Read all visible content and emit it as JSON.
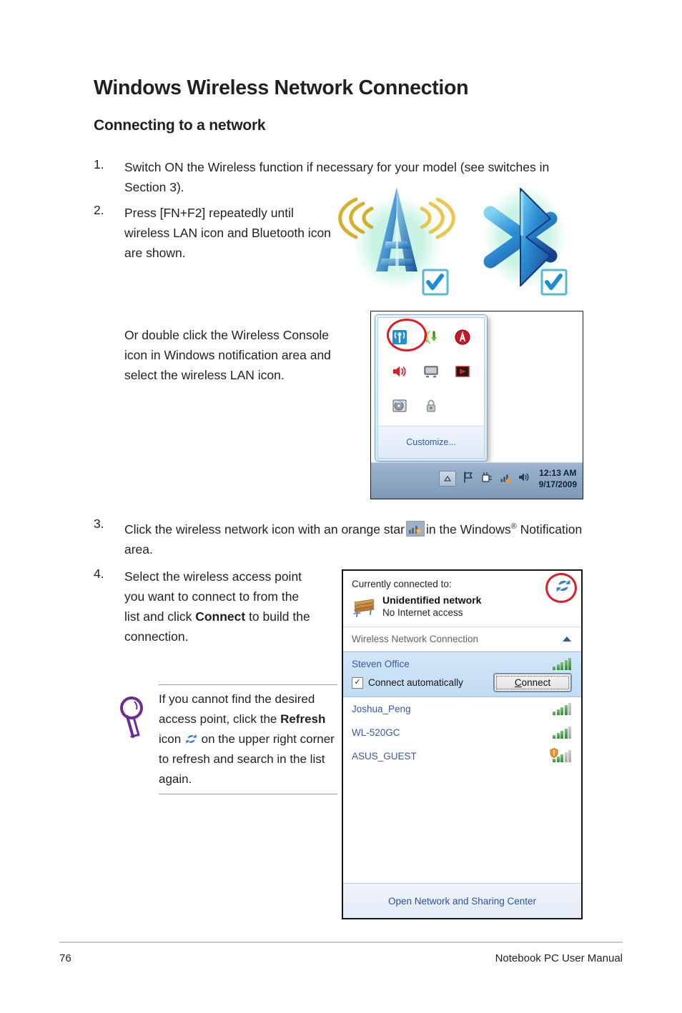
{
  "page": {
    "title": "Windows Wireless Network Connection",
    "section_title": "Connecting to a network"
  },
  "steps": [
    {
      "number": "1.",
      "text": "Switch ON the Wireless function if necessary for your model (see switches in Section 3)."
    },
    {
      "number": "2.",
      "text": "Press [FN+F2] repeatedly until wireless LAN icon and Bluetooth icon are shown."
    }
  ],
  "or_paragraph": "Or double click the Wireless Console icon in Windows notification area and select the wireless LAN icon.",
  "step3": {
    "number": "3.",
    "text_before": "Click the wireless network icon with an orange star",
    "text_after": "in the Windows",
    "registered": "®",
    "text_after2": " Notification area."
  },
  "step4": {
    "number": "4.",
    "text_before": "Select the wireless access point you want to connect to from the list and click ",
    "bold": "Connect",
    "text_after": " to build the connection."
  },
  "note": {
    "text_before": "If you cannot find the desired access point, click the ",
    "bold": "Refresh",
    "text_mid": " icon ",
    "text_after": " on the upper right corner to refresh and search in the list again.",
    "icon": "magnifier-icon",
    "inline_icon": "refresh-icon"
  },
  "hero_icons": {
    "wireless": {
      "name": "wireless-tower-icon",
      "checked": true
    },
    "bluetooth": {
      "name": "bluetooth-icon",
      "checked": true
    }
  },
  "tray_screenshot": {
    "icons": [
      {
        "name": "wireless-console-icon",
        "highlighted": true
      },
      {
        "name": "network-download-icon",
        "highlighted": false
      },
      {
        "name": "security-alert-icon",
        "highlighted": false
      },
      {
        "name": "volume-mute-icon",
        "highlighted": false
      },
      {
        "name": "display-icon",
        "highlighted": false
      },
      {
        "name": "media-icon",
        "highlighted": false
      },
      {
        "name": "disk-icon",
        "highlighted": false
      },
      {
        "name": "lock-icon",
        "highlighted": false
      }
    ],
    "customize_label": "Customize...",
    "taskbar": {
      "show_hidden_icons": "show-hidden-icons-button",
      "flag_icon": "action-center-flag-icon",
      "usb_icon": "safely-remove-hardware-icon",
      "network_icon": "wireless-network-star-icon",
      "volume_icon": "volume-icon",
      "time": "12:13 AM",
      "date": "9/17/2009"
    }
  },
  "wifi_dialog": {
    "currently_connected_label": "Currently connected to:",
    "connected_network": "Unidentified network",
    "connected_status": "No Internet access",
    "refresh_button": "refresh-icon",
    "adapter_label": "Wireless Network Connection",
    "collapse_icon": "chevron-up-icon",
    "networks": [
      {
        "ssid": "Steven Office",
        "bars": 4,
        "total_bars": 5,
        "secured": false,
        "selected": true
      },
      {
        "ssid": "Joshua_Peng",
        "bars": 4,
        "total_bars": 5,
        "secured": false,
        "selected": false
      },
      {
        "ssid": "WL-520GC",
        "bars": 4,
        "total_bars": 5,
        "secured": false,
        "selected": false
      },
      {
        "ssid": "ASUS_GUEST",
        "bars": 3,
        "total_bars": 5,
        "secured": true,
        "selected": false
      }
    ],
    "connect_automatically_label": "Connect automatically",
    "connect_automatically_checked": true,
    "connect_button_label": "Connect",
    "connect_button_accesskey": "C",
    "footer_link": "Open Network and Sharing Center"
  },
  "footer": {
    "page_number": "76",
    "manual_title": "Notebook PC User Manual"
  },
  "colors": {
    "accent_blue": "#3a57a8",
    "link_blue": "#2b52a0",
    "highlight_red": "#e01b24",
    "note_purple": "#6d2d91",
    "signal_green": "#2e8a35",
    "star_orange": "#f79521"
  }
}
